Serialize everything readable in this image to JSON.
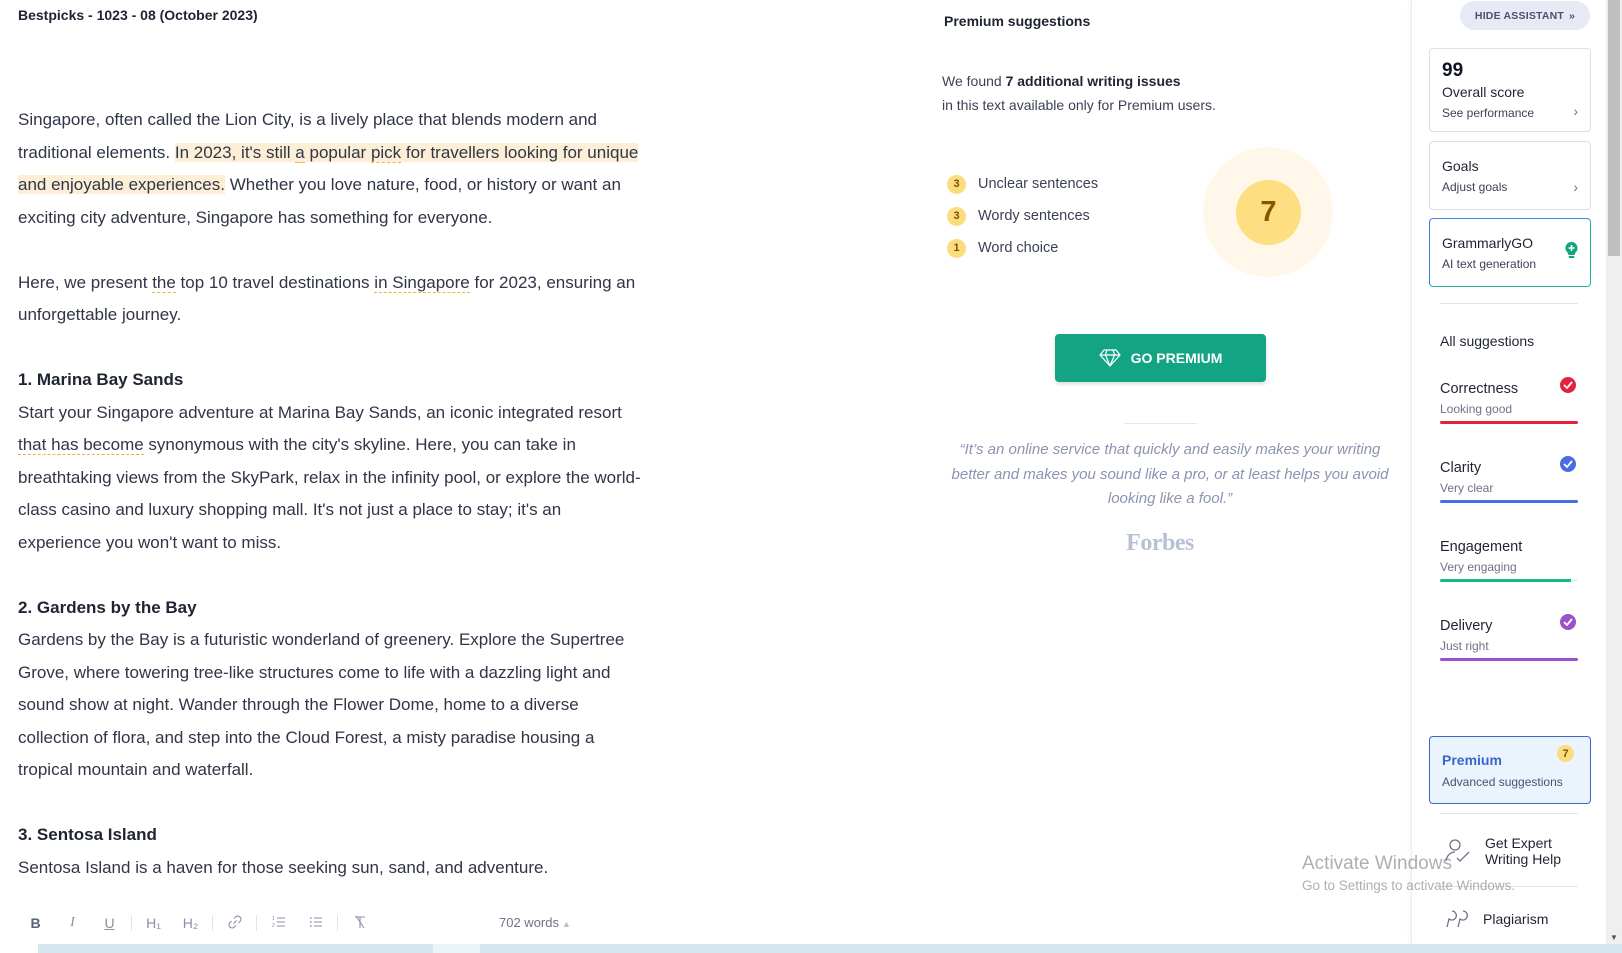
{
  "document": {
    "title": "Bestpicks - 1023 - 08 (October 2023)",
    "paragraphs": {
      "p1_a": "Singapore, often called the Lion City, is a lively place that blends modern and traditional elements. ",
      "p1_hl_a": "In 2023, it's still ",
      "p1_hl_u1": "a",
      "p1_hl_b": " popular ",
      "p1_hl_u2": "pick",
      "p1_hl_c": " for travellers looking for unique and enjoyable experiences.",
      "p1_b": " Whether you love nature, food, or history or want an exciting city adventure, Singapore has something for everyone.",
      "p2_a": "Here, we present ",
      "p2_u1": "the",
      "p2_b": " top 10 travel destinations ",
      "p2_u2": "in Singapore",
      "p2_c": " for 2023, ensuring an unforgettable journey."
    },
    "sections": [
      {
        "heading": "1. Marina Bay Sands",
        "text_a": "Start your Singapore adventure at Marina Bay Sands, an iconic integrated resort ",
        "text_u": "that has become",
        "text_b": " synonymous with the city's skyline. Here, you can take in breathtaking views from the SkyPark, relax in the infinity pool, or explore the world-class casino and luxury shopping mall. It's not just a place to stay; it's an experience you won't want to miss."
      },
      {
        "heading": "2. Gardens by the Bay",
        "text": "Gardens by the Bay is a futuristic wonderland of greenery. Explore the Supertree Grove, where towering tree-like structures come to life with a dazzling light and sound show at night. Wander through the Flower Dome, home to a diverse collection of flora, and step into the Cloud Forest, a misty paradise housing a tropical mountain and waterfall."
      },
      {
        "heading": "3. Sentosa Island",
        "text": "Sentosa Island is a haven for those seeking sun, sand, and adventure."
      }
    ]
  },
  "toolbar": {
    "bold": "B",
    "italic": "I",
    "underline": "U",
    "h1": "H₁",
    "h2": "H₂",
    "link": "✐",
    "ordered_list": "☰",
    "unordered_list": "∷",
    "clear_format": "T̸",
    "word_count": "702 words"
  },
  "premium_panel": {
    "title": "Premium suggestions",
    "found_prefix": "We found ",
    "found_bold": "7 additional writing issues",
    "found_suffix": "in this text available only for Premium users.",
    "issues": [
      {
        "count": "3",
        "label": "Unclear sentences"
      },
      {
        "count": "3",
        "label": "Wordy sentences"
      },
      {
        "count": "1",
        "label": "Word choice"
      }
    ],
    "total": "7",
    "go_premium_label": "GO PREMIUM",
    "quote": "“It’s an online service that quickly and easily makes your writing better and makes you sound like a pro, or at least helps you avoid looking like a fool.”",
    "quote_source": "Forbes"
  },
  "sidebar": {
    "hide_assistant": "HIDE ASSISTANT",
    "score": {
      "value": "99",
      "label": "Overall score",
      "link": "See performance"
    },
    "goals": {
      "label": "Goals",
      "link": "Adjust goals"
    },
    "grammarly_go": {
      "label": "GrammarlyGO",
      "sub": "AI text generation"
    },
    "all_suggestions": "All suggestions",
    "categories": [
      {
        "name": "Correctness",
        "status": "Looking good",
        "color": "#e5213f",
        "checked": true,
        "progress": 1.0
      },
      {
        "name": "Clarity",
        "status": "Very clear",
        "color": "#4a6ee0",
        "checked": true,
        "progress": 1.0
      },
      {
        "name": "Engagement",
        "status": "Very engaging",
        "color": "#16b98a",
        "checked": false,
        "progress": 0.95
      },
      {
        "name": "Delivery",
        "status": "Just right",
        "color": "#9b51c9",
        "checked": true,
        "progress": 1.0
      }
    ],
    "premium": {
      "label": "Premium",
      "sub": "Advanced suggestions",
      "count": "7"
    },
    "expert_help": "Get Expert Writing Help",
    "expert_help_line1": "Get Expert",
    "expert_help_line2": "Writing Help",
    "plagiarism": "Plagiarism"
  },
  "watermark": {
    "line1": "Activate Windows",
    "line2": "Go to Settings to activate Windows."
  },
  "colors": {
    "brand_green": "#13a583",
    "highlight": "#fdefd6",
    "badge_yellow": "#fddc7f",
    "premium_blue": "#3b66c9"
  }
}
